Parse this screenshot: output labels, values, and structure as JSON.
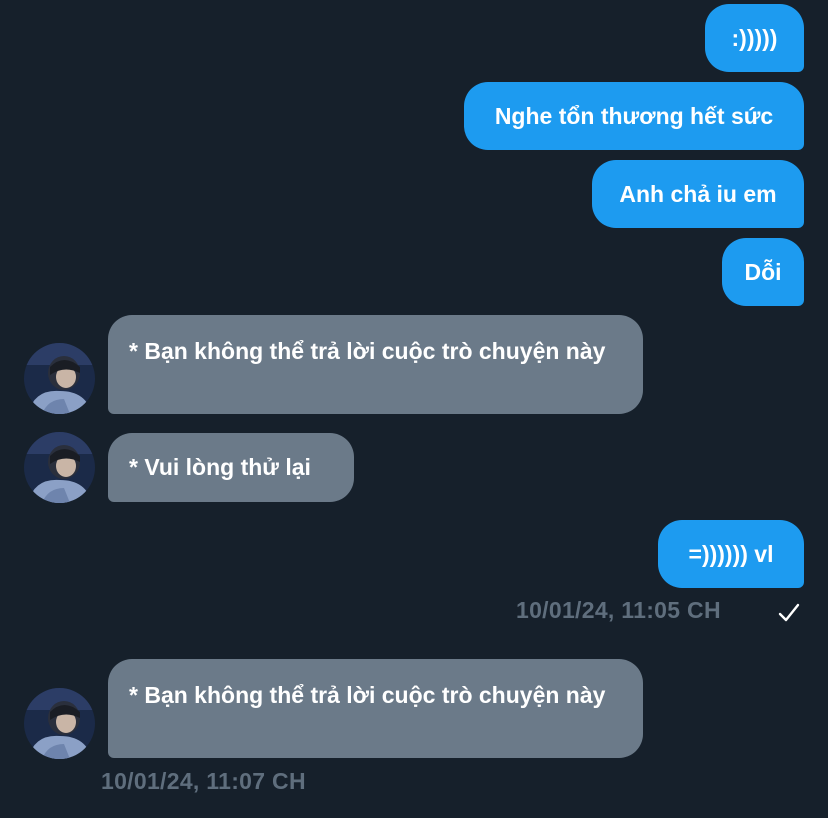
{
  "messages": {
    "out_1": ":)))))",
    "out_2": "Nghe tổn thương hết sức",
    "out_3": "Anh chả iu em",
    "out_4": "Dỗi",
    "in_1": "* Bạn không thể trả lời cuộc trò chuyện này",
    "in_2": "* Vui lòng thử lại",
    "out_5": "=)))))) vl",
    "in_3": "* Bạn không thể trả lời cuộc trò chuyện này"
  },
  "timestamps": {
    "sent": "10/01/24, 11:05 CH",
    "received": "10/01/24, 11:07 CH"
  },
  "icons": {
    "read_receipt": "check-icon",
    "avatar": "avatar"
  },
  "colors": {
    "background": "#16202b",
    "outgoing_bubble": "#1d9bf0",
    "incoming_bubble": "#6b7a89",
    "timestamp": "#5f6e7d"
  }
}
